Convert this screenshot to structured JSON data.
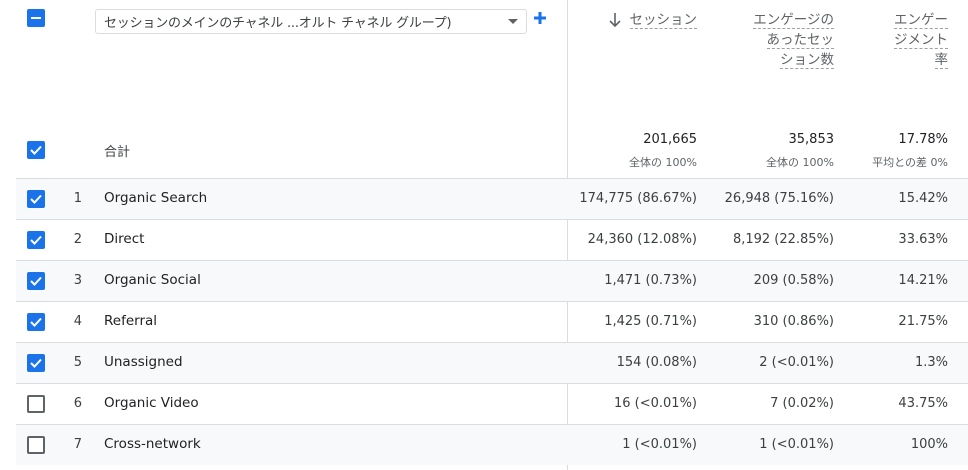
{
  "header": {
    "dimension_select_label": "セッションのメインのチャネル ...オルト チャネル グループ)",
    "metrics": [
      {
        "lines": [
          "セッション"
        ]
      },
      {
        "lines": [
          "エンゲージの",
          "あったセッ",
          "ション数"
        ]
      },
      {
        "lines": [
          "エンゲー",
          "ジメント",
          "率"
        ]
      }
    ]
  },
  "totals": {
    "label": "合計",
    "values": [
      "201,665",
      "35,853",
      "17.78%"
    ],
    "subs": [
      "全体の 100%",
      "全体の 100%",
      "平均との差 0%"
    ]
  },
  "rows": [
    {
      "index": "1",
      "name": "Organic Search",
      "checked": true,
      "v1": "174,775 (86.67%)",
      "v2": "26,948 (75.16%)",
      "v3": "15.42%"
    },
    {
      "index": "2",
      "name": "Direct",
      "checked": true,
      "v1": "24,360 (12.08%)",
      "v2": "8,192 (22.85%)",
      "v3": "33.63%"
    },
    {
      "index": "3",
      "name": "Organic Social",
      "checked": true,
      "v1": "1,471 (0.73%)",
      "v2": "209 (0.58%)",
      "v3": "14.21%"
    },
    {
      "index": "4",
      "name": "Referral",
      "checked": true,
      "v1": "1,425 (0.71%)",
      "v2": "310 (0.86%)",
      "v3": "21.75%"
    },
    {
      "index": "5",
      "name": "Unassigned",
      "checked": true,
      "v1": "154 (0.08%)",
      "v2": "2 (<0.01%)",
      "v3": "1.3%"
    },
    {
      "index": "6",
      "name": "Organic Video",
      "checked": false,
      "v1": "16 (<0.01%)",
      "v2": "7 (0.02%)",
      "v3": "43.75%"
    },
    {
      "index": "7",
      "name": "Cross-network",
      "checked": false,
      "v1": "1 (<0.01%)",
      "v2": "1 (<0.01%)",
      "v3": "100%"
    }
  ],
  "colors": {
    "accent": "#1a73e8",
    "border": "#dadce0",
    "row_shade": "#f8f9fa"
  },
  "icons": {
    "select_all": "indeterminate-checkbox-icon",
    "add": "plus-icon",
    "sort": "arrow-down-icon",
    "dropdown": "caret-down-icon"
  }
}
